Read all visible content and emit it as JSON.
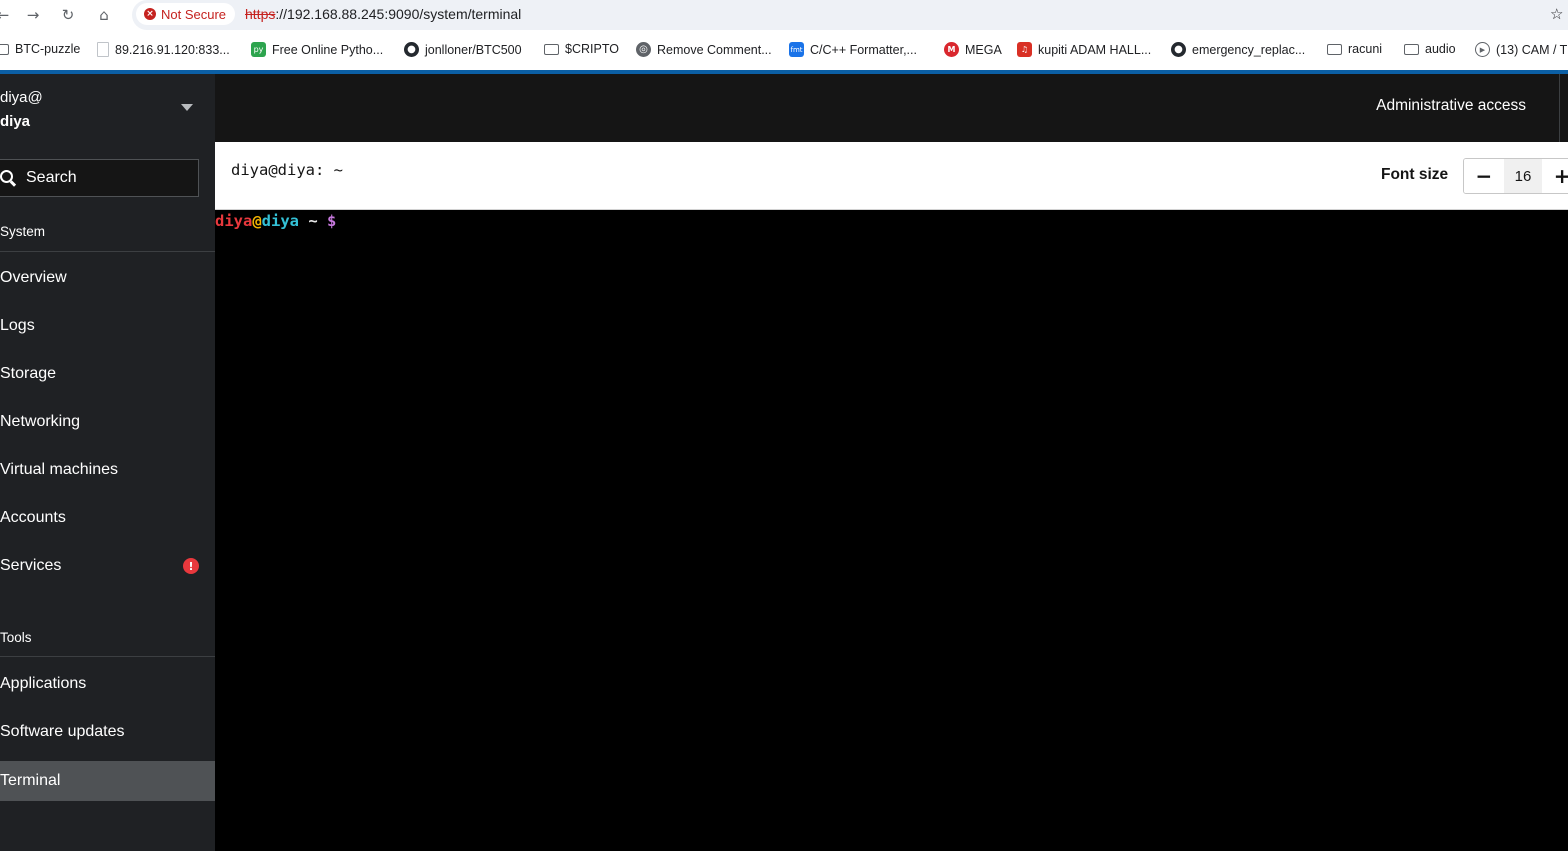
{
  "browser": {
    "security_label": "Not Secure",
    "url_scheme": "https",
    "url_rest": "://192.168.88.245:9090/system/terminal",
    "bookmarks": [
      {
        "label": "BTC-puzzle",
        "icon": "folder-icon"
      },
      {
        "label": "89.216.91.120:833...",
        "icon": "file-icon"
      },
      {
        "label": "Free Online Pytho...",
        "icon": "python-site-icon"
      },
      {
        "label": "jonlloner/BTC500",
        "icon": "github-icon"
      },
      {
        "label": "$CRIPTO",
        "icon": "folder-icon"
      },
      {
        "label": "Remove Comment...",
        "icon": "globe-icon"
      },
      {
        "label": "C/C++ Formatter,...",
        "icon": "fmt-icon"
      },
      {
        "label": "MEGA",
        "icon": "mega-icon"
      },
      {
        "label": "kupiti ADAM HALL...",
        "icon": "shop-icon"
      },
      {
        "label": "emergency_replac...",
        "icon": "github-icon"
      },
      {
        "label": "racuni",
        "icon": "folder-icon"
      },
      {
        "label": "audio",
        "icon": "folder-icon"
      },
      {
        "label": "(13) CAM / T",
        "icon": "play-icon"
      }
    ]
  },
  "sidebar": {
    "user": "diya@",
    "host": "diya",
    "search_label": "Search",
    "system_section": "System",
    "system_items": [
      {
        "label": "Overview"
      },
      {
        "label": "Logs"
      },
      {
        "label": "Storage"
      },
      {
        "label": "Networking"
      },
      {
        "label": "Virtual machines"
      },
      {
        "label": "Accounts"
      },
      {
        "label": "Services",
        "alert": "!"
      }
    ],
    "tools_section": "Tools",
    "tools_items": [
      {
        "label": "Applications"
      },
      {
        "label": "Software updates"
      },
      {
        "label": "Terminal",
        "active": true
      }
    ]
  },
  "masthead": {
    "admin_label": "Administrative access"
  },
  "terminal": {
    "title": "diya@diya: ~",
    "font_size_label": "Font size",
    "font_size_value": "16",
    "decrease_symbol": "−",
    "increase_symbol": "+",
    "prompt_user": "diya",
    "prompt_at": "@",
    "prompt_host": "diya",
    "prompt_path": " ~ ",
    "prompt_symbol": "$",
    "colors": {
      "user": "#e8383d",
      "host": "#33c1d6",
      "dollar": "#c678dd"
    }
  }
}
